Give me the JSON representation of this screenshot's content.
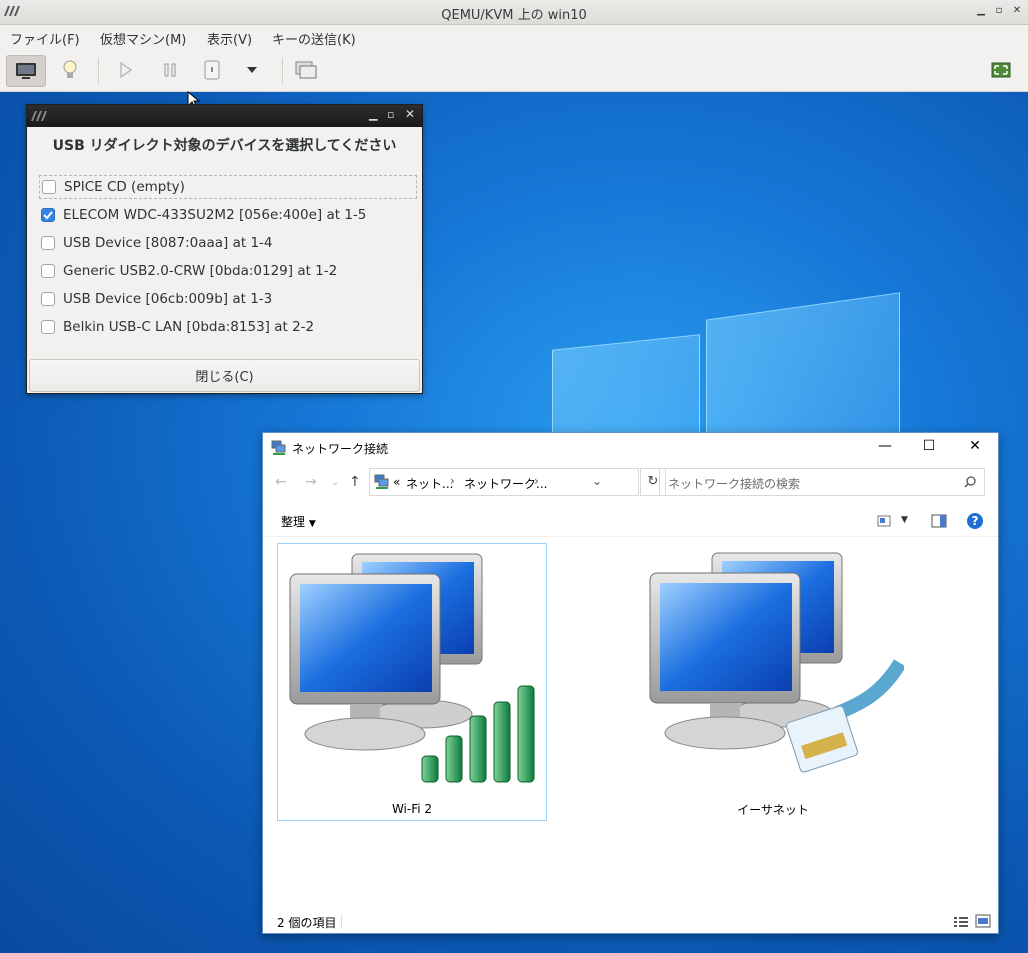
{
  "window": {
    "title": "QEMU/KVM 上の win10"
  },
  "menubar": {
    "items": [
      "ファイル(F)",
      "仮想マシン(M)",
      "表示(V)",
      "キーの送信(K)"
    ]
  },
  "usb_dialog": {
    "heading": "USB リダイレクト対象のデバイスを選択してください",
    "devices": [
      {
        "label": "SPICE CD (empty)",
        "checked": false
      },
      {
        "label": "ELECOM WDC-433SU2M2 [056e:400e] at 1-5",
        "checked": true
      },
      {
        "label": "USB Device [8087:0aaa] at 1-4",
        "checked": false
      },
      {
        "label": "Generic USB2.0-CRW [0bda:0129] at 1-2",
        "checked": false
      },
      {
        "label": "USB Device [06cb:009b] at 1-3",
        "checked": false
      },
      {
        "label": "Belkin USB-C LAN [0bda:8153] at 2-2",
        "checked": false
      }
    ],
    "close_label": "閉じる(C)"
  },
  "explorer": {
    "title": "ネットワーク接続",
    "address": {
      "prefix": "«",
      "crumbs": [
        "ネット...",
        "ネットワーク..."
      ]
    },
    "search_placeholder": "ネットワーク接続の検索",
    "organize_label": "整理",
    "items": [
      {
        "label": "Wi-Fi 2",
        "kind": "wifi",
        "selected": true
      },
      {
        "label": "イーサネット",
        "kind": "ethernet",
        "selected": false
      }
    ],
    "status": "2 個の項目"
  },
  "colors": {
    "desktop": "#1677d6",
    "accent": "#3584e4",
    "help": "#1f6fd1"
  }
}
